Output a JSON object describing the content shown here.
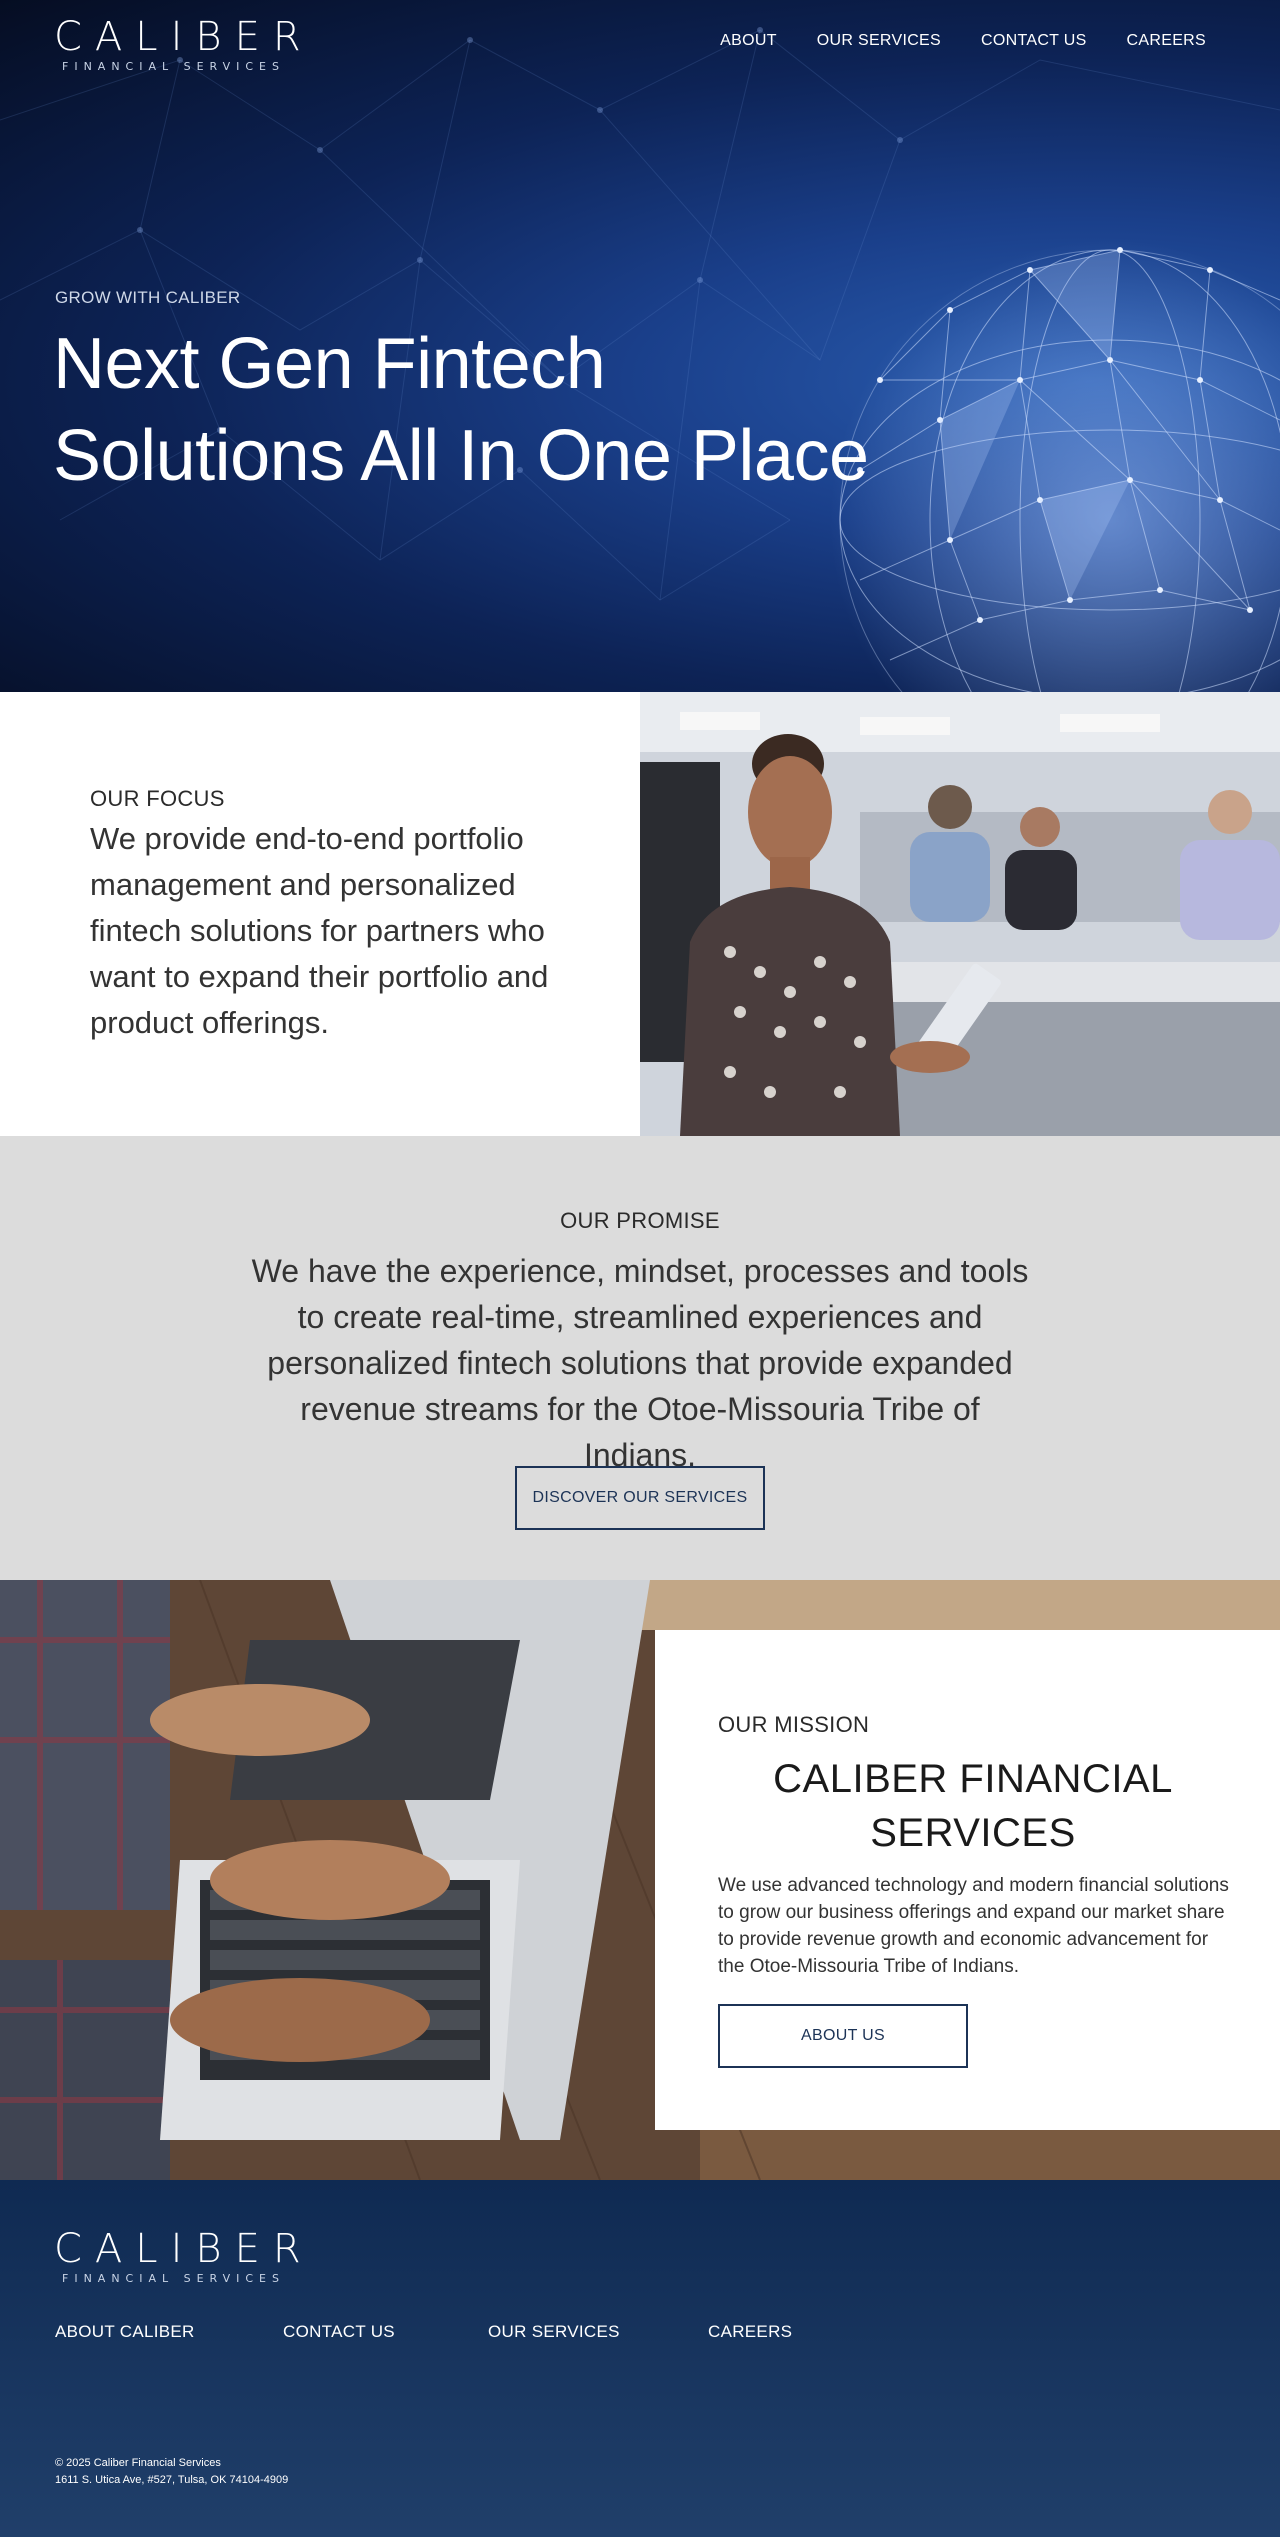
{
  "brand": {
    "name": "CALIBER",
    "tagline": "FINANCIAL SERVICES"
  },
  "nav": {
    "items": [
      {
        "label": "ABOUT"
      },
      {
        "label": "OUR SERVICES"
      },
      {
        "label": "CONTACT US"
      },
      {
        "label": "CAREERS"
      }
    ]
  },
  "hero": {
    "eyebrow": "GROW WITH CALIBER",
    "title_line1": "Next Gen Fintech",
    "title_line2": "Solutions All In One Place"
  },
  "focus": {
    "eyebrow": "OUR FOCUS",
    "body": "We provide end-to-end portfolio management and personalized fintech solutions for partners who want to expand their portfolio and product offerings."
  },
  "promise": {
    "eyebrow": "OUR PROMISE",
    "body": "We have the experience, mindset, processes and tools to create real-time, streamlined experiences and personalized fintech solutions that provide expanded revenue streams for the Otoe-Missouria Tribe of Indians.",
    "button": "DISCOVER OUR SERVICES"
  },
  "mission": {
    "eyebrow": "OUR MISSION",
    "title": "CALIBER FINANCIAL SERVICES",
    "body": "We use advanced technology and modern financial solutions to grow our business offerings and expand our market share to provide revenue growth and economic advancement for the Otoe-Missouria Tribe of Indians.",
    "button": "ABOUT US"
  },
  "footer": {
    "nav": [
      {
        "label": "ABOUT CALIBER"
      },
      {
        "label": "CONTACT US"
      },
      {
        "label": "OUR SERVICES"
      },
      {
        "label": "CAREERS"
      }
    ],
    "copyright": "© 2025 Caliber Financial Services",
    "address": "1611 S. Utica Ave, #527, Tulsa, OK 74104-4909"
  },
  "colors": {
    "hero_dark": "#050d22",
    "hero_blue": "#1a3f8a",
    "navy": "#1c3356",
    "promise_bg": "#dcdcdc",
    "footer_bg": "#0f2a52"
  },
  "icons": [
    "caliber-logo-icon",
    "globe-network-icon"
  ]
}
